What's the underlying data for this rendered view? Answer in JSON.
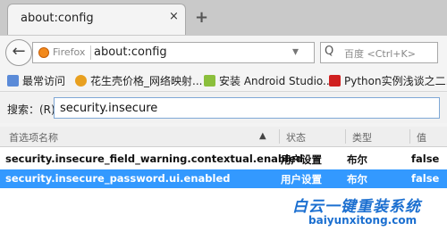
{
  "tab": {
    "title": "about:config",
    "close": "×",
    "new_tab": "+"
  },
  "navbar": {
    "back": "←",
    "identity_label": "Firefox",
    "url": "about:config",
    "dropmarker": "▾",
    "search_icon": "Q",
    "search_placeholder": "百度 <Ctrl+K>"
  },
  "bookmarks": [
    {
      "label": "最常访问",
      "icon": "bookmark-icon",
      "color": "#5b8bd8"
    },
    {
      "label": "花生壳价格_网络映射...",
      "icon": "peanut-icon",
      "color": "#e8a020"
    },
    {
      "label": "安装 Android Studio...",
      "icon": "android-icon",
      "color": "#8bbf3c"
    },
    {
      "label": "Python实例浅谈之二...",
      "icon": "site-c-icon",
      "color": "#d02020"
    }
  ],
  "search": {
    "label": "搜索：(R)",
    "value": "security.insecure"
  },
  "table": {
    "headers": {
      "name": "首选项名称",
      "status": "状态",
      "type": "类型",
      "value": "值"
    },
    "sort_indicator": "▲",
    "rows": [
      {
        "name": "security.insecure_field_warning.contextual.enabled",
        "status": "用户设置",
        "type": "布尔",
        "value": "false",
        "selected": false
      },
      {
        "name": "security.insecure_password.ui.enabled",
        "status": "用户设置",
        "type": "布尔",
        "value": "false",
        "selected": true
      }
    ]
  },
  "watermark": {
    "title": "白云一键重装系统",
    "url": "baiyunxitong.com"
  },
  "colors": {
    "selection": "#3399ff",
    "firefox_orange": "#f28a1d",
    "watermark_blue": "#1b6fd0"
  }
}
